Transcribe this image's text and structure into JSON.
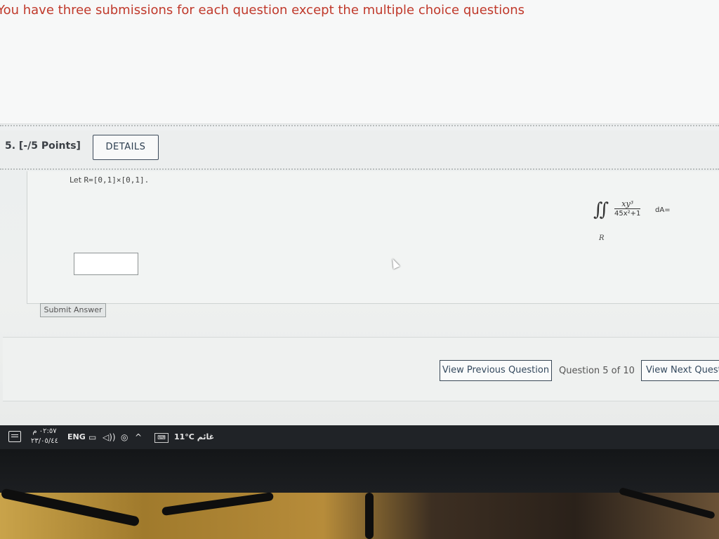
{
  "banner": {
    "text": "You have three submissions for each question except the multiple choice questions",
    "color": "#c0392b"
  },
  "question": {
    "number_points": "5. [-/5 Points]",
    "details_label": "DETAILS",
    "let_label": "Let",
    "region_def": "R=[0,1]×[0,1].",
    "integral": {
      "sign": "∬",
      "numerator": "xy³",
      "denominator": "45x²+1",
      "differential": "dA=",
      "region": "R"
    },
    "answer_value": "",
    "submit_label": "Submit Answer"
  },
  "navigation": {
    "prev_label": "View Previous Question",
    "counter": "Question 5 of 10",
    "next_label": "View Next Questi"
  },
  "taskbar": {
    "time": "٠٢:٥٧ م",
    "date": "٢٣/٠٥/٤٤",
    "language": "ENG",
    "weather": "11°C غائم",
    "icons": [
      "notification-icon",
      "network-icon",
      "volume-icon",
      "battery-icon",
      "chevron-up-icon",
      "keyboard-icon"
    ]
  }
}
